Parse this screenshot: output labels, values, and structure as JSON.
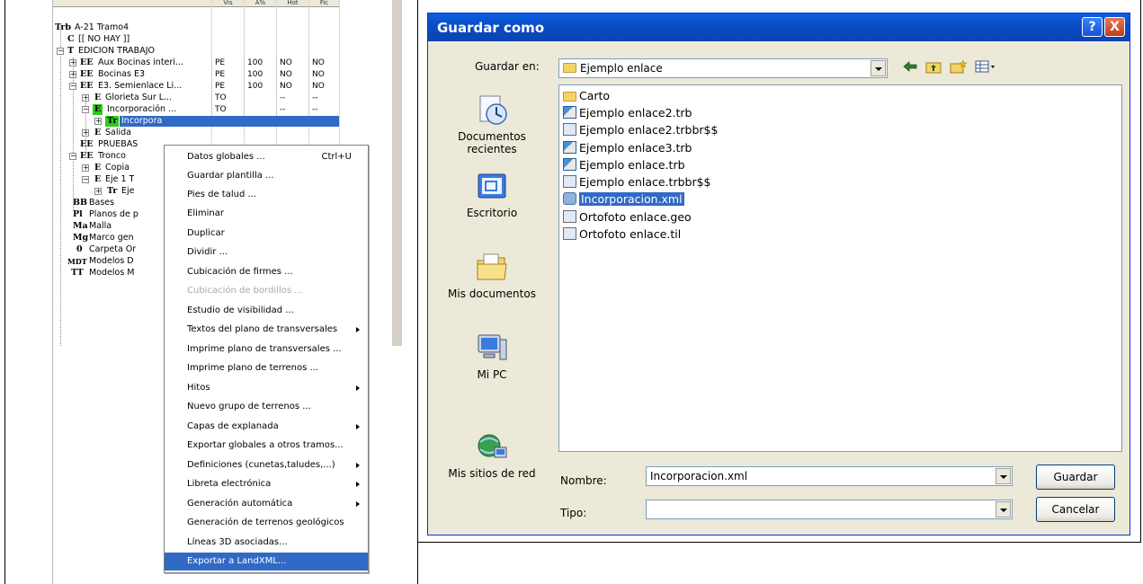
{
  "tree": {
    "columns": [
      "Vis",
      "A%",
      "Hot",
      "Fic"
    ],
    "rows": [
      {
        "type": "Trb",
        "label": "A-21 Tramo4",
        "vis": "",
        "pct": "",
        "hot": "",
        "fic": ""
      },
      {
        "type": "C",
        "label": "[[ NO HAY ]]",
        "vis": "",
        "pct": "",
        "hot": "",
        "fic": ""
      },
      {
        "type": "T",
        "label": "EDICION TRABAJO",
        "vis": "",
        "pct": "",
        "hot": "",
        "fic": ""
      },
      {
        "type": "EE",
        "label": "Aux Bocinas interi...",
        "vis": "PE",
        "pct": "100",
        "hot": "NO",
        "fic": "NO"
      },
      {
        "type": "EE",
        "label": "Bocinas E3",
        "vis": "PE",
        "pct": "100",
        "hot": "NO",
        "fic": "NO"
      },
      {
        "type": "EE",
        "label": "E3. Semienlace Li...",
        "vis": "PE",
        "pct": "100",
        "hot": "NO",
        "fic": "NO"
      },
      {
        "type": "E",
        "label": "Glorieta Sur L...",
        "vis": "TO",
        "pct": "",
        "hot": "--",
        "fic": "--"
      },
      {
        "type": "E",
        "label": "Incorporación ...",
        "vis": "TO",
        "pct": "",
        "hot": "--",
        "fic": "--"
      },
      {
        "type": "Tr",
        "label": "Incorpora",
        "vis": "",
        "pct": "",
        "hot": "",
        "fic": ""
      },
      {
        "type": "E",
        "label": "Salida",
        "vis": "",
        "pct": "",
        "hot": "",
        "fic": ""
      },
      {
        "type": "EE",
        "label": "PRUEBAS",
        "vis": "",
        "pct": "",
        "hot": "",
        "fic": ""
      },
      {
        "type": "EE",
        "label": "Tronco",
        "vis": "",
        "pct": "",
        "hot": "",
        "fic": ""
      },
      {
        "type": "E",
        "label": "Copia",
        "vis": "",
        "pct": "",
        "hot": "",
        "fic": ""
      },
      {
        "type": "E",
        "label": "Eje 1 T",
        "vis": "",
        "pct": "",
        "hot": "",
        "fic": ""
      },
      {
        "type": "Tr",
        "label": "Eje",
        "vis": "",
        "pct": "",
        "hot": "",
        "fic": ""
      },
      {
        "type": "BB",
        "label": "Bases",
        "vis": "",
        "pct": "",
        "hot": "",
        "fic": ""
      },
      {
        "type": "Pl",
        "label": "Planos de p",
        "vis": "",
        "pct": "",
        "hot": "",
        "fic": ""
      },
      {
        "type": "Ma",
        "label": "Malla",
        "vis": "",
        "pct": "",
        "hot": "",
        "fic": ""
      },
      {
        "type": "Mg",
        "label": "Marco gen",
        "vis": "",
        "pct": "",
        "hot": "",
        "fic": ""
      },
      {
        "type": "0",
        "label": "Carpeta Or",
        "vis": "",
        "pct": "",
        "hot": "",
        "fic": ""
      },
      {
        "type": "MDT",
        "label": "Modelos D",
        "vis": "",
        "pct": "",
        "hot": "",
        "fic": ""
      },
      {
        "type": "TT",
        "label": "Modelos M",
        "vis": "",
        "pct": "",
        "hot": "",
        "fic": ""
      }
    ]
  },
  "context_menu": {
    "items": [
      {
        "label": "Datos globales ...",
        "shortcut": "Ctrl+U",
        "submenu": false,
        "disabled": false
      },
      {
        "label": "Guardar plantilla ...",
        "shortcut": "",
        "submenu": false,
        "disabled": false
      },
      {
        "label": "Pies de talud ...",
        "shortcut": "",
        "submenu": false,
        "disabled": false
      },
      {
        "label": "Eliminar",
        "shortcut": "",
        "submenu": false,
        "disabled": false
      },
      {
        "label": "Duplicar",
        "shortcut": "",
        "submenu": false,
        "disabled": false
      },
      {
        "label": "Dividir ...",
        "shortcut": "",
        "submenu": false,
        "disabled": false
      },
      {
        "label": "Cubicación de firmes ...",
        "shortcut": "",
        "submenu": false,
        "disabled": false
      },
      {
        "label": "Cubicación de bordillos ...",
        "shortcut": "",
        "submenu": false,
        "disabled": true
      },
      {
        "label": "Estudio de visibilidad ...",
        "shortcut": "",
        "submenu": false,
        "disabled": false
      },
      {
        "label": "Textos del plano de transversales",
        "shortcut": "",
        "submenu": true,
        "disabled": false
      },
      {
        "label": "Imprime plano de transversales ...",
        "shortcut": "",
        "submenu": false,
        "disabled": false
      },
      {
        "label": "Imprime plano de terrenos ...",
        "shortcut": "",
        "submenu": false,
        "disabled": false
      },
      {
        "label": "Hitos",
        "shortcut": "",
        "submenu": true,
        "disabled": false
      },
      {
        "label": "Nuevo grupo de terrenos ...",
        "shortcut": "",
        "submenu": false,
        "disabled": false
      },
      {
        "label": "Capas de explanada",
        "shortcut": "",
        "submenu": true,
        "disabled": false
      },
      {
        "label": "Exportar globales a otros tramos...",
        "shortcut": "",
        "submenu": false,
        "disabled": false
      },
      {
        "label": "Definiciones (cunetas,taludes,...)",
        "shortcut": "",
        "submenu": true,
        "disabled": false
      },
      {
        "label": "Libreta electrónica",
        "shortcut": "",
        "submenu": true,
        "disabled": false
      },
      {
        "label": "Generación automática",
        "shortcut": "",
        "submenu": true,
        "disabled": false
      },
      {
        "label": "Generación de terrenos geológicos",
        "shortcut": "",
        "submenu": false,
        "disabled": false
      },
      {
        "label": "Líneas 3D asociadas...",
        "shortcut": "",
        "submenu": false,
        "disabled": false
      },
      {
        "label": "Exportar a LandXML...",
        "shortcut": "",
        "submenu": false,
        "disabled": false,
        "highlighted": true
      }
    ]
  },
  "dialog": {
    "title": "Guardar como",
    "help_label": "?",
    "close_label": "X",
    "save_in_label": "Guardar en:",
    "save_in_value": "Ejemplo enlace",
    "places": [
      {
        "label": "Documentos recientes",
        "icon": "recent-documents-icon"
      },
      {
        "label": "Escritorio",
        "icon": "desktop-icon"
      },
      {
        "label": "Mis documentos",
        "icon": "my-documents-icon"
      },
      {
        "label": "Mi PC",
        "icon": "my-computer-icon"
      },
      {
        "label": "Mis sitios de red",
        "icon": "network-places-icon"
      }
    ],
    "files": [
      {
        "name": "Carto",
        "kind": "folder"
      },
      {
        "name": "Ejemplo enlace2.trb",
        "kind": "trb"
      },
      {
        "name": "Ejemplo enlace2.trbbr$$",
        "kind": "generic"
      },
      {
        "name": "Ejemplo enlace3.trb",
        "kind": "trb"
      },
      {
        "name": "Ejemplo enlace.trb",
        "kind": "trb"
      },
      {
        "name": "Ejemplo enlace.trbbr$$",
        "kind": "generic"
      },
      {
        "name": "Incorporacion.xml",
        "kind": "xml",
        "selected": true
      },
      {
        "name": "Ortofoto enlace.geo",
        "kind": "generic"
      },
      {
        "name": "Ortofoto enlace.til",
        "kind": "generic"
      }
    ],
    "name_label": "Nombre:",
    "name_value": "Incorporacion.xml",
    "type_label": "Tipo:",
    "type_value": "",
    "save_button": "Guardar",
    "cancel_button": "Cancelar"
  },
  "colors": {
    "titlebar": "#0b4ec6",
    "selection": "#316ac5",
    "tree_selected": "#2ecc1a"
  }
}
